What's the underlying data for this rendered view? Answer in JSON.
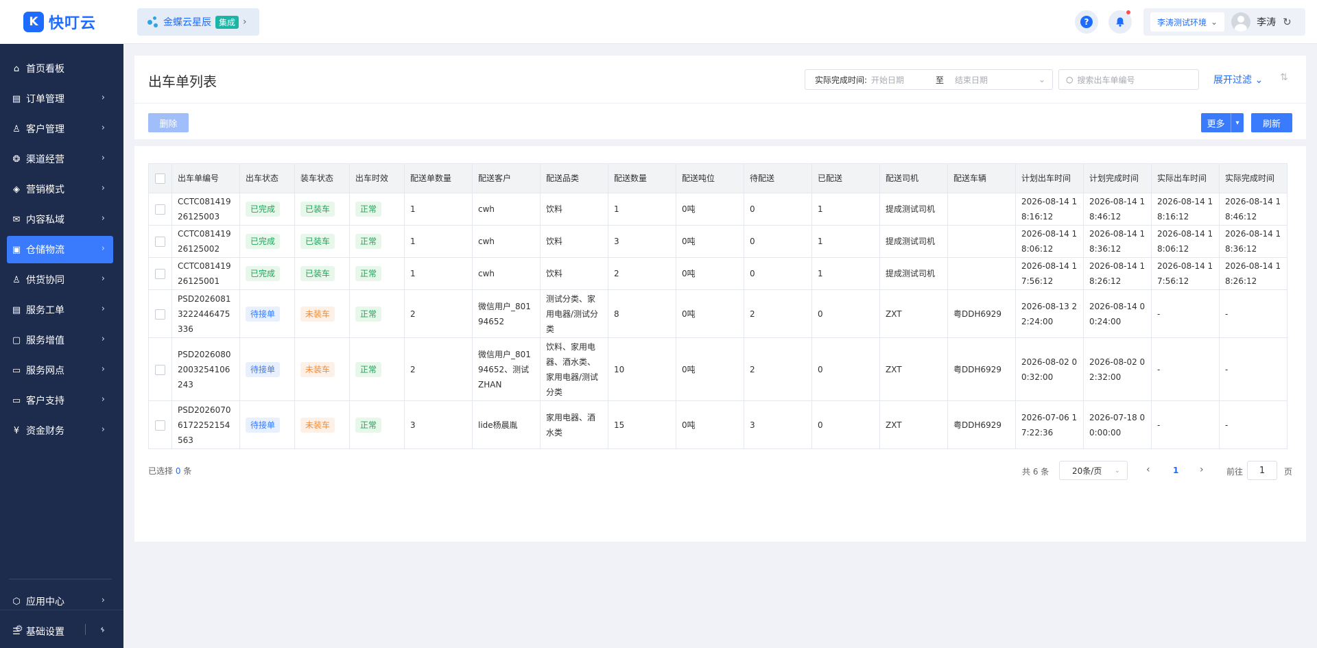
{
  "header": {
    "logo_text": "快叮云",
    "integration_name": "金蝶云星辰",
    "integration_tag": "集成",
    "environment": "李涛测试环境",
    "user_name": "李涛"
  },
  "sidebar": {
    "items": [
      {
        "label": "首页看板",
        "icon": "home-icon",
        "has_arrow": false
      },
      {
        "label": "订单管理",
        "icon": "order-icon",
        "has_arrow": true
      },
      {
        "label": "客户管理",
        "icon": "user-icon",
        "has_arrow": true
      },
      {
        "label": "渠道经营",
        "icon": "channel-icon",
        "has_arrow": true
      },
      {
        "label": "营销模式",
        "icon": "marketing-icon",
        "has_arrow": true
      },
      {
        "label": "内容私域",
        "icon": "content-icon",
        "has_arrow": true
      },
      {
        "label": "仓储物流",
        "icon": "warehouse-icon",
        "has_arrow": true,
        "active": true
      },
      {
        "label": "供货协同",
        "icon": "supply-icon",
        "has_arrow": true
      },
      {
        "label": "服务工单",
        "icon": "ticket-icon",
        "has_arrow": true
      },
      {
        "label": "服务增值",
        "icon": "bag-icon",
        "has_arrow": true
      },
      {
        "label": "服务网点",
        "icon": "store-icon",
        "has_arrow": true
      },
      {
        "label": "客户支持",
        "icon": "support-icon",
        "has_arrow": true
      },
      {
        "label": "资金财务",
        "icon": "finance-icon",
        "has_arrow": true
      }
    ],
    "bottom_items": [
      {
        "label": "应用中心",
        "icon": "app-center-icon"
      },
      {
        "label": "基础设置",
        "icon": "settings-list-icon"
      }
    ]
  },
  "page": {
    "title": "出车单列表",
    "filter_label": "实际完成时间:",
    "start_placeholder": "开始日期",
    "to_label": "至",
    "end_placeholder": "结束日期",
    "search_placeholder": "搜索出车单编号",
    "expand_filter": "展开过滤",
    "delete_button": "删除",
    "more_button": "更多",
    "refresh_button": "刷新"
  },
  "table": {
    "columns": [
      "出车单编号",
      "出车状态",
      "装车状态",
      "出车时效",
      "配送单数量",
      "配送客户",
      "配送品类",
      "配送数量",
      "配送吨位",
      "待配送",
      "已配送",
      "配送司机",
      "配送车辆",
      "计划出车时间",
      "计划完成时间",
      "实际出车时间",
      "实际完成时间"
    ],
    "rows": [
      {
        "id": "CCTC08141926125003",
        "status": "已完成",
        "status_type": "green",
        "load": "已装车",
        "load_type": "green",
        "timeliness": "正常",
        "orders": "1",
        "customer": "cwh",
        "category": "饮料",
        "qty": "1",
        "tonnage": "0吨",
        "pending": "0",
        "delivered": "1",
        "driver": "提成测试司机",
        "vehicle": "",
        "plan_depart": "2026-08-14 18:16:12",
        "plan_finish": "2026-08-14 18:46:12",
        "actual_depart": "2026-08-14 18:16:12",
        "actual_finish": "2026-08-14 18:46:12"
      },
      {
        "id": "CCTC08141926125002",
        "status": "已完成",
        "status_type": "green",
        "load": "已装车",
        "load_type": "green",
        "timeliness": "正常",
        "orders": "1",
        "customer": "cwh",
        "category": "饮料",
        "qty": "3",
        "tonnage": "0吨",
        "pending": "0",
        "delivered": "1",
        "driver": "提成测试司机",
        "vehicle": "",
        "plan_depart": "2026-08-14 18:06:12",
        "plan_finish": "2026-08-14 18:36:12",
        "actual_depart": "2026-08-14 18:06:12",
        "actual_finish": "2026-08-14 18:36:12"
      },
      {
        "id": "CCTC08141926125001",
        "status": "已完成",
        "status_type": "green",
        "load": "已装车",
        "load_type": "green",
        "timeliness": "正常",
        "orders": "1",
        "customer": "cwh",
        "category": "饮料",
        "qty": "2",
        "tonnage": "0吨",
        "pending": "0",
        "delivered": "1",
        "driver": "提成测试司机",
        "vehicle": "",
        "plan_depart": "2026-08-14 17:56:12",
        "plan_finish": "2026-08-14 18:26:12",
        "actual_depart": "2026-08-14 17:56:12",
        "actual_finish": "2026-08-14 18:26:12"
      },
      {
        "id": "PSD20260813222446475336",
        "status": "待接单",
        "status_type": "blue",
        "load": "未装车",
        "load_type": "orange",
        "timeliness": "正常",
        "orders": "2",
        "customer": "微信用户_80194652",
        "category": "测试分类、家用电器/测试分类",
        "qty": "8",
        "tonnage": "0吨",
        "pending": "2",
        "delivered": "0",
        "driver": "ZXT",
        "vehicle": "粤DDH6929",
        "plan_depart": "2026-08-13 22:24:00",
        "plan_finish": "2026-08-14 00:24:00",
        "actual_depart": "-",
        "actual_finish": "-"
      },
      {
        "id": "PSD20260802003254106243",
        "status": "待接单",
        "status_type": "blue",
        "load": "未装车",
        "load_type": "orange",
        "timeliness": "正常",
        "orders": "2",
        "customer": "微信用户_80194652、测试ZHAN",
        "category": "饮料、家用电器、酒水类、家用电器/测试分类",
        "qty": "10",
        "tonnage": "0吨",
        "pending": "2",
        "delivered": "0",
        "driver": "ZXT",
        "vehicle": "粤DDH6929",
        "plan_depart": "2026-08-02 00:32:00",
        "plan_finish": "2026-08-02 02:32:00",
        "actual_depart": "-",
        "actual_finish": "-"
      },
      {
        "id": "PSD20260706172252154563",
        "status": "待接单",
        "status_type": "blue",
        "load": "未装车",
        "load_type": "orange",
        "timeliness": "正常",
        "orders": "3",
        "customer": "lide杨晨胤",
        "category": "家用电器、酒水类",
        "qty": "15",
        "tonnage": "0吨",
        "pending": "3",
        "delivered": "0",
        "driver": "ZXT",
        "vehicle": "粤DDH6929",
        "plan_depart": "2026-07-06 17:22:36",
        "plan_finish": "2026-07-18 00:00:00",
        "actual_depart": "-",
        "actual_finish": "-"
      }
    ]
  },
  "footer": {
    "selected_prefix": "已选择",
    "selected_count": "0",
    "selected_suffix": "条",
    "total": "共 6 条",
    "page_size": "20条/页",
    "current_page": "1",
    "goto_label": "前往",
    "goto_value": "1",
    "page_label": "页"
  },
  "colors": {
    "accent": "#3a7bfd",
    "sidebar_bg": "#1d2b4c",
    "tag_green": "#21a35c",
    "tag_blue": "#3a7bfd",
    "tag_orange": "#f08c3a"
  }
}
